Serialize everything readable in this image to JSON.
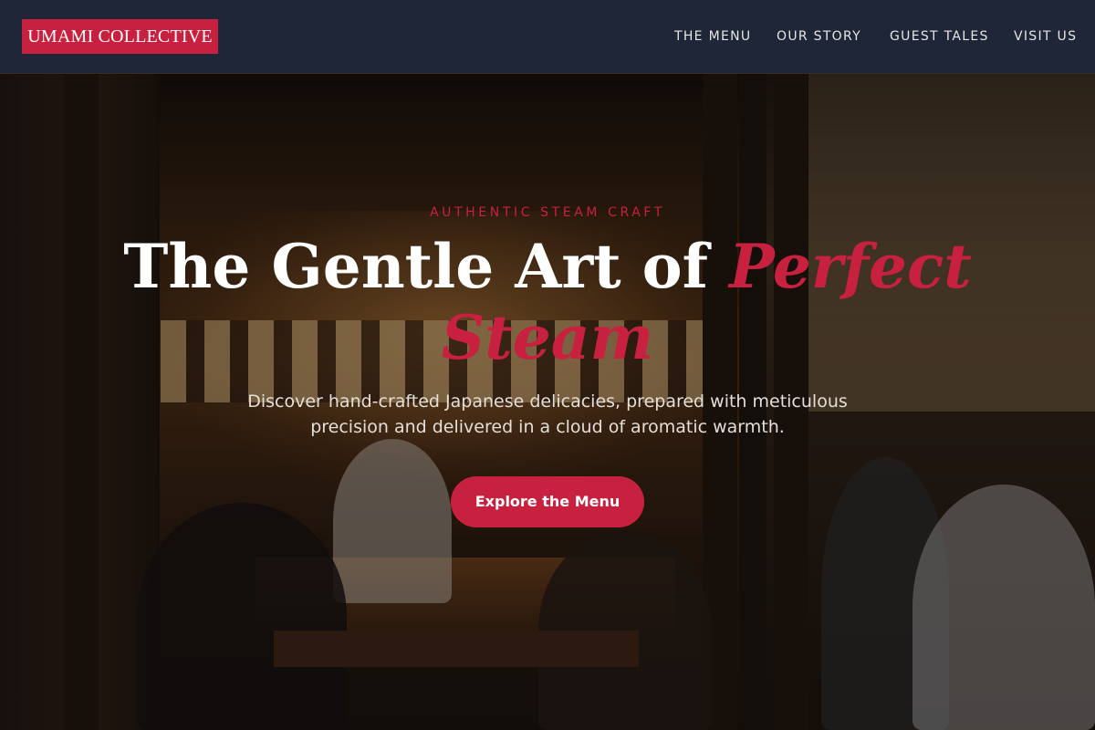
{
  "header": {
    "logo_text": "UMAMI COLLECTIVE",
    "nav": [
      {
        "label": "THE MENU"
      },
      {
        "label": "OUR STORY"
      },
      {
        "label": "GUEST TALES"
      },
      {
        "label": "VISIT US"
      }
    ]
  },
  "hero": {
    "eyebrow": "AUTHENTIC STEAM CRAFT",
    "headline_main": "The Gentle Art of ",
    "headline_accent": "Perfect Steam",
    "subtitle": "Discover hand-crafted Japanese delicacies, prepared with meticulous precision and delivered in a cloud of aromatic warmth.",
    "cta_label": "Explore the Menu"
  },
  "colors": {
    "accent": "#c8203f",
    "header_bg": "#1e2637",
    "text_light": "#ffffff"
  }
}
